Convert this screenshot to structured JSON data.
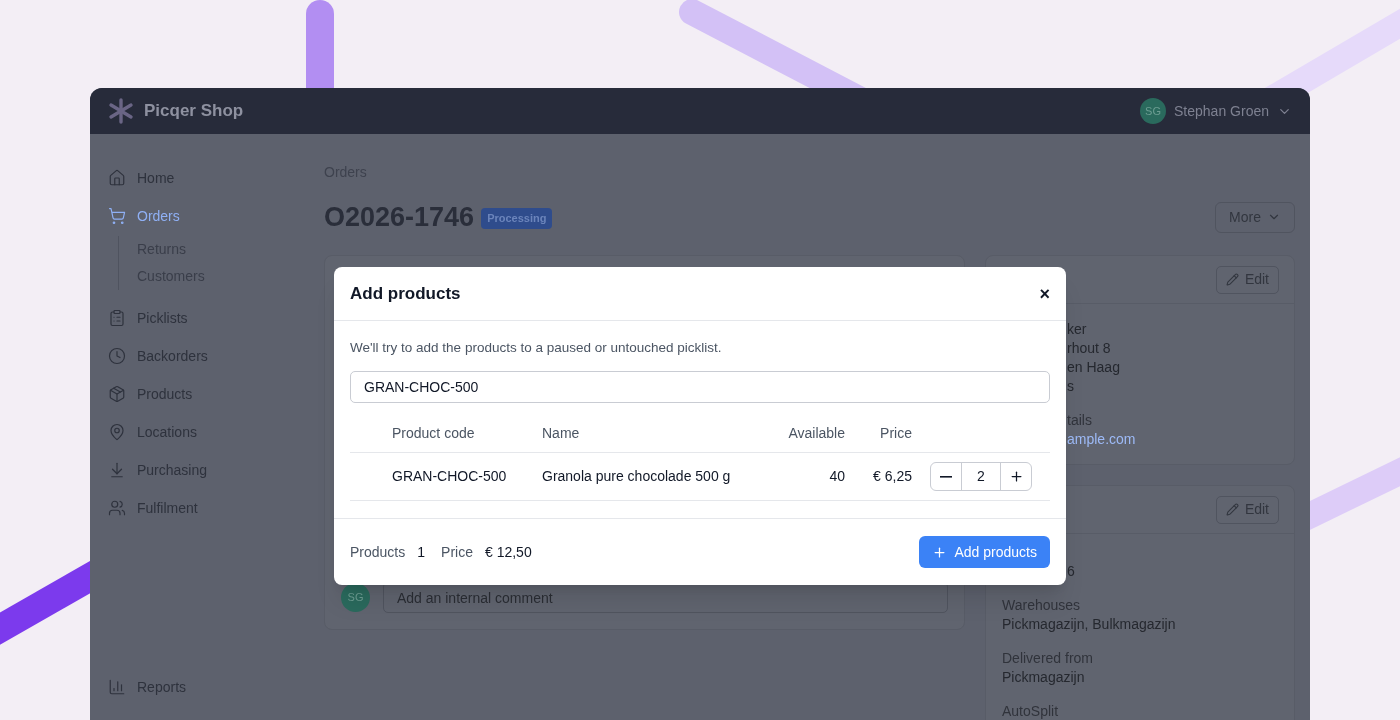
{
  "app": {
    "name": "Picqer Shop",
    "user": {
      "initials": "SG",
      "name": "Stephan Groen"
    }
  },
  "sidebar": {
    "items": [
      {
        "label": "Home",
        "selected": false
      },
      {
        "label": "Orders",
        "selected": true,
        "children": [
          {
            "label": "Returns"
          },
          {
            "label": "Customers"
          }
        ]
      },
      {
        "label": "Picklists",
        "selected": false
      },
      {
        "label": "Backorders",
        "selected": false
      },
      {
        "label": "Products",
        "selected": false
      },
      {
        "label": "Locations",
        "selected": false
      },
      {
        "label": "Purchasing",
        "selected": false
      },
      {
        "label": "Fulfilment",
        "selected": false
      }
    ],
    "footer_items": [
      {
        "label": "Reports",
        "selected": false
      }
    ]
  },
  "breadcrumb": "Orders",
  "order": {
    "number": "O2026-1746",
    "status": "Processing"
  },
  "more_button": "More",
  "comment": {
    "initials": "SG",
    "placeholder": "Add an internal comment"
  },
  "side_cards": [
    {
      "button": "Edit",
      "lines": [
        {
          "kind": "value",
          "text": "ker"
        },
        {
          "kind": "value",
          "text": "rhout 8"
        },
        {
          "kind": "value",
          "text": "en Haag"
        },
        {
          "kind": "value",
          "text": "s"
        },
        {
          "kind": "label",
          "text": "tails"
        },
        {
          "kind": "link",
          "text": "ample.com"
        }
      ]
    },
    {
      "button": "Edit",
      "lines": [
        {
          "kind": "value",
          "text": "6"
        },
        {
          "kind": "label",
          "text": "Warehouses"
        },
        {
          "kind": "value",
          "text": "Pickmagazijn, Bulkmagazijn"
        },
        {
          "kind": "label",
          "text": "Delivered from"
        },
        {
          "kind": "value",
          "text": "Pickmagazijn"
        },
        {
          "kind": "label",
          "text": "AutoSplit"
        }
      ]
    }
  ],
  "modal": {
    "title": "Add products",
    "close": "×",
    "description": "We'll try to add the products to a paused or untouched picklist.",
    "search": {
      "value": "GRAN-CHOC-500"
    },
    "columns": [
      "Product code",
      "Name",
      "Available",
      "Price"
    ],
    "rows": [
      {
        "code": "GRAN-CHOC-500",
        "name": "Granola pure chocolade 500 g",
        "available": "40",
        "price": "€ 6,25",
        "quantity": "2"
      }
    ],
    "summary": {
      "products_label": "Products",
      "products": "1",
      "price_label": "Price",
      "price": "€ 12,50"
    },
    "submit": "Add products"
  }
}
